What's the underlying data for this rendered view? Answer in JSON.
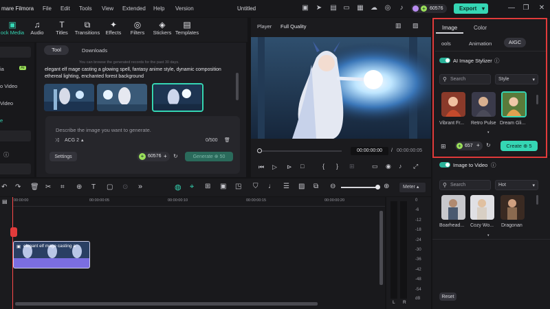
{
  "titlebar": {
    "app": "mare Filmora",
    "menus": [
      "File",
      "Edit",
      "Tools",
      "View",
      "Extended",
      "Help",
      "Version"
    ],
    "doc_title": "Untitled",
    "credits": "60576",
    "export": "Export"
  },
  "toolbar": {
    "items": [
      "ock Media",
      "Audio",
      "Titles",
      "Transitions",
      "Effects",
      "Filters",
      "Stickers",
      "Templates"
    ]
  },
  "leftnav": {
    "items": [
      "ia",
      "o Video",
      "Video",
      "e"
    ],
    "ai_badge": "AI"
  },
  "aigen": {
    "tab_tool": "Tool",
    "tab_downloads": "Downloads",
    "hint": "You can browse the generated records for the past 30 days.",
    "prompt_text": "elegant elf mage casting a glowing spell, fantasy anime style, dynamic composition ethereal lighting, enchanted forest background",
    "placeholder": "Describe the image you want to generate.",
    "model": "ACG 2",
    "counter": "0/500",
    "settings": "Settings",
    "credits": "60576",
    "generate": "Generate",
    "gen_cost": "50"
  },
  "player": {
    "label": "Player",
    "quality": "Full Quality",
    "time_current": "00:00:00:00",
    "time_total": "00:00:00:05"
  },
  "timeline": {
    "meter": "Meter",
    "ruler": [
      "00:00:00",
      "00:00:00:05",
      "00:00:00:10",
      "00:00:00:15",
      "00:00:00:20"
    ],
    "clip_label": "elegant elf mage casting a",
    "meter_scale": [
      "0",
      "-6",
      "-12",
      "-18",
      "-24",
      "-30",
      "-36",
      "-42",
      "-48",
      "-54"
    ],
    "meter_db": "dB",
    "meter_l": "L",
    "meter_r": "R"
  },
  "right": {
    "tab_image": "Image",
    "tab_color": "Color",
    "sub_tools": "ools",
    "sub_animation": "Animation",
    "sub_aigc": "AIGC",
    "stylizer": "AI Image Stylizer",
    "search": "Search",
    "style": "Style",
    "styles": [
      "Vibrant Fr...",
      "Retro Pulse",
      "Dream Gli..."
    ],
    "cost": "657",
    "create": "Create",
    "create_cost": "5",
    "i2v": "Image to Video",
    "search2": "Search",
    "hot": "Hot",
    "videos": [
      "Boarhead...",
      "Cozy Wo...",
      "Dragonan"
    ],
    "reset": "Reset"
  },
  "colors": {
    "accent": "#2bb39a",
    "export_btn": "#35d6b4",
    "highlight": "#e23b3b",
    "playhead": "#ff4a4a",
    "clip": "#7b6ee0"
  }
}
